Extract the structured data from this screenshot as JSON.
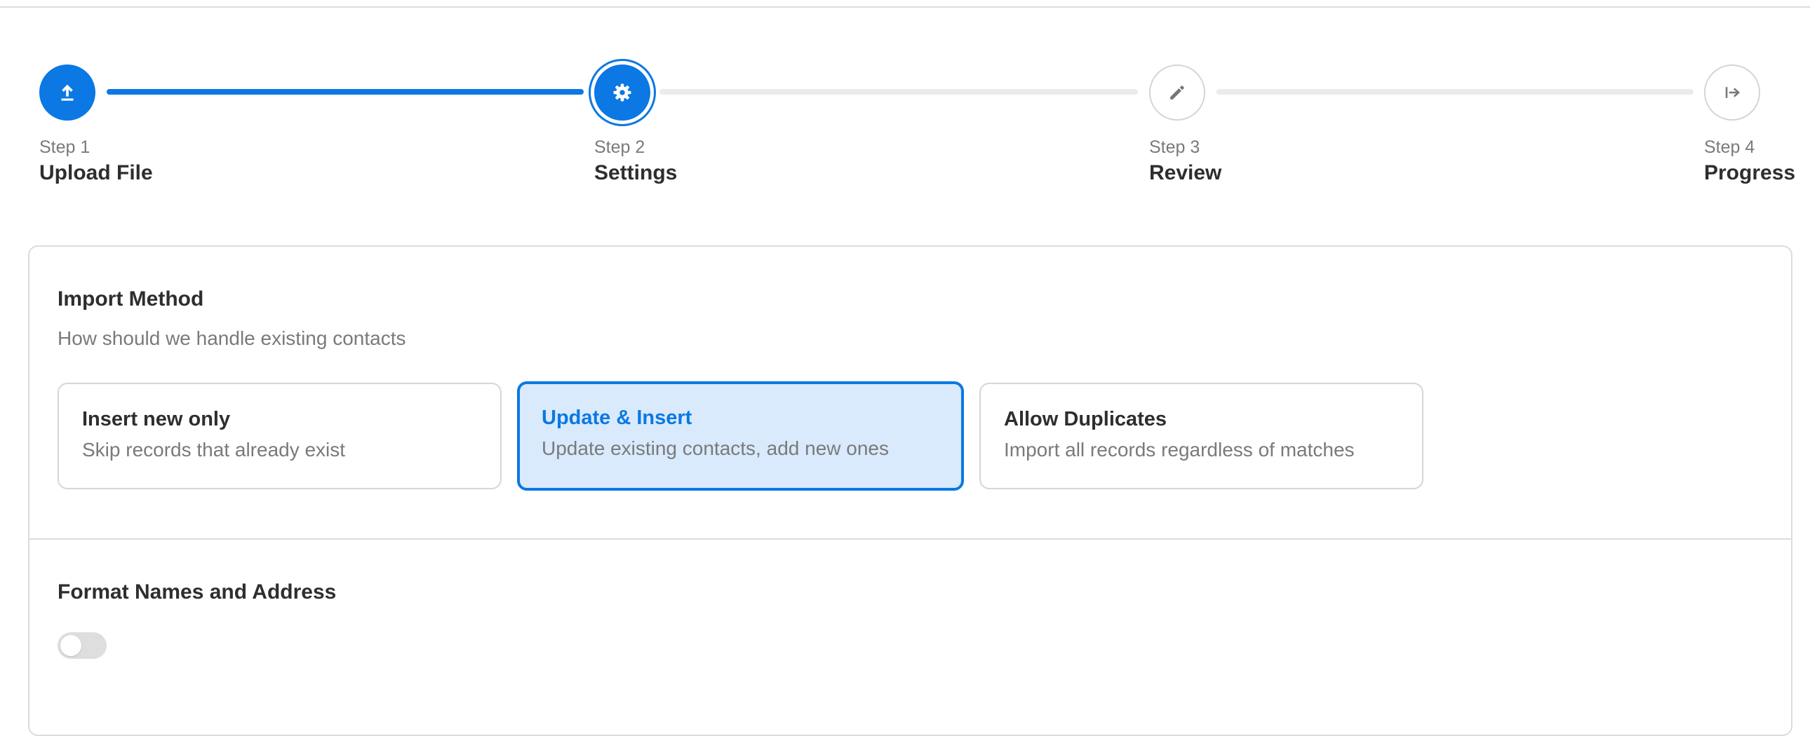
{
  "stepper": {
    "steps": [
      {
        "number": "Step 1",
        "title": "Upload File",
        "icon": "upload-icon",
        "state": "done"
      },
      {
        "number": "Step 2",
        "title": "Settings",
        "icon": "gear-icon",
        "state": "active"
      },
      {
        "number": "Step 3",
        "title": "Review",
        "icon": "pencil-icon",
        "state": "pending"
      },
      {
        "number": "Step 4",
        "title": "Progress",
        "icon": "arrow-right-to-bar-icon",
        "state": "pending"
      }
    ]
  },
  "import_method": {
    "title": "Import Method",
    "subtitle": "How should we handle existing contacts",
    "options": [
      {
        "title": "Insert new only",
        "description": "Skip records that already exist",
        "selected": false
      },
      {
        "title": "Update & Insert",
        "description": "Update existing contacts, add new ones",
        "selected": true
      },
      {
        "title": "Allow Duplicates",
        "description": "Import all records regardless of matches",
        "selected": false
      }
    ]
  },
  "format": {
    "title": "Format Names and Address",
    "toggle_on": false
  },
  "colors": {
    "accent": "#0b78e3",
    "selected_bg": "#d8eafb",
    "border": "#dcdcdc"
  }
}
